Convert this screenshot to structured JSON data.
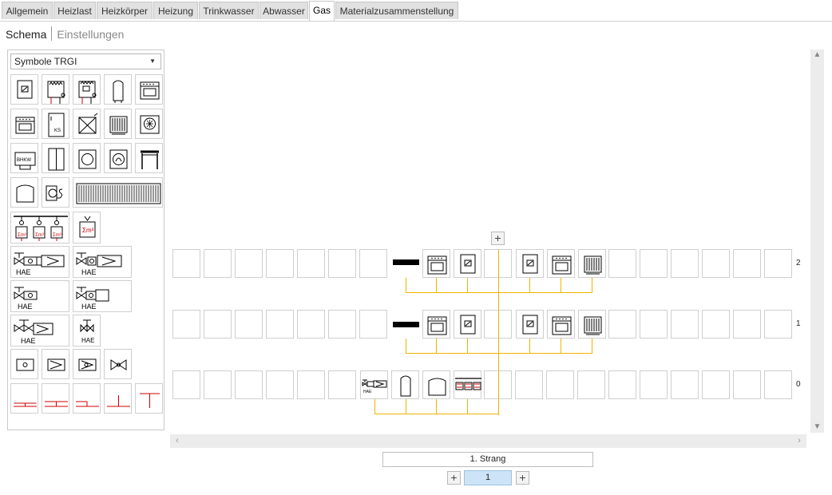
{
  "tabs": [
    {
      "label": "Allgemein",
      "active": false
    },
    {
      "label": "Heizlast",
      "active": false
    },
    {
      "label": "Heizkörper",
      "active": false
    },
    {
      "label": "Heizung",
      "active": false
    },
    {
      "label": "Trinkwasser",
      "active": false
    },
    {
      "label": "Abwasser",
      "active": false
    },
    {
      "label": "Gas",
      "active": true
    },
    {
      "label": "Materialzusammenstellung",
      "active": false
    }
  ],
  "subtabs": {
    "schema": "Schema",
    "settings": "Einstellungen"
  },
  "palette": {
    "select_value": "Symbole TRGI",
    "symbol_texts": {
      "ks": "KS",
      "bhkw": "BHKW",
      "hae": "HAE",
      "sum_m3": "Σm³"
    }
  },
  "floors": [
    "2",
    "1",
    "0"
  ],
  "strang": {
    "label": "1. Strang",
    "number": "1",
    "add": "+"
  },
  "canvas_add": "+",
  "colors": {
    "pipe": "#f0b400",
    "accent_red": "#cc0000",
    "selected": "#cde3f7"
  }
}
